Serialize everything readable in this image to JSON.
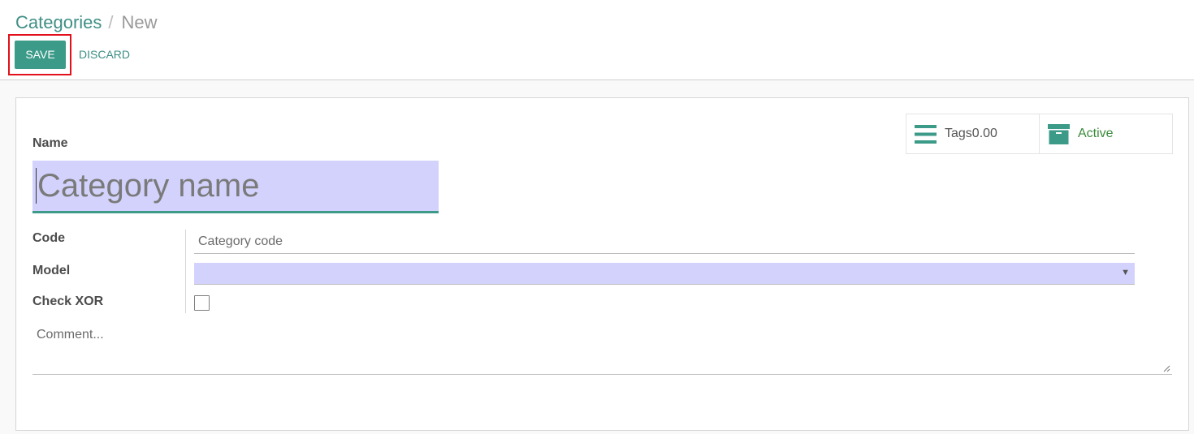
{
  "breadcrumb": {
    "parent": "Categories",
    "separator": "/",
    "current": "New"
  },
  "toolbar": {
    "save_label": "SAVE",
    "discard_label": "DISCARD",
    "highlight_color": "#e3101b"
  },
  "stat_buttons": [
    {
      "icon": "list-icon",
      "label": "Tags0.00"
    },
    {
      "icon": "archive-icon",
      "label": "Active"
    }
  ],
  "form": {
    "name_label": "Name",
    "name_placeholder": "Category name",
    "code_label": "Code",
    "code_placeholder": "Category code",
    "model_label": "Model",
    "model_value": "",
    "model_arrow": "▼",
    "check_xor_label": "Check XOR",
    "check_xor_checked": false,
    "comment_placeholder": "Comment..."
  },
  "colors": {
    "accent": "#3b9a88",
    "link": "#3f8f85",
    "required_field_bg": "#d2d2fd",
    "active_green": "#3c8a3c"
  }
}
